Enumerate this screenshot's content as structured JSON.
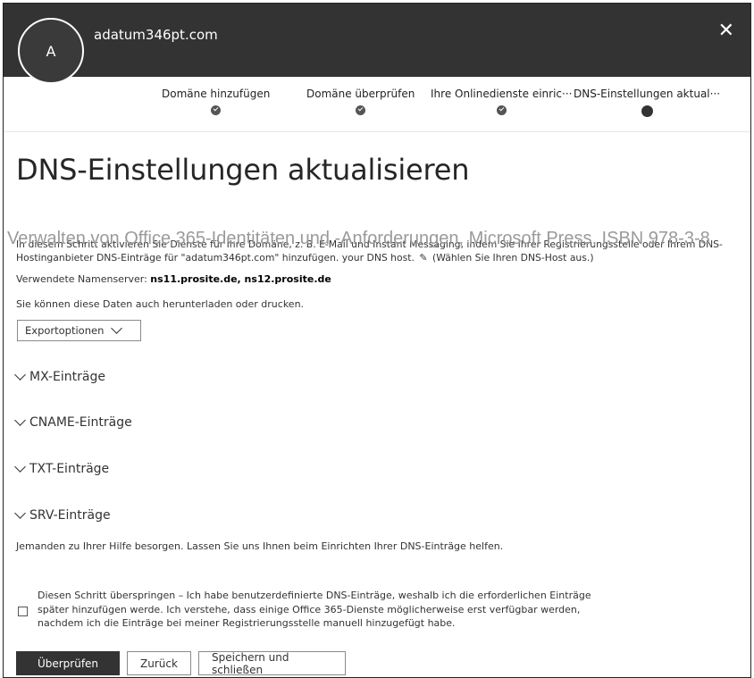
{
  "header": {
    "avatar_initial": "A",
    "domain": "adatum346pt.com",
    "close_glyph": "✕"
  },
  "steps": [
    {
      "label": "Domäne hinzufügen",
      "state": "done"
    },
    {
      "label": "Domäne überprüfen",
      "state": "done"
    },
    {
      "label": "Ihre Onlinedienste einric···",
      "state": "done"
    },
    {
      "label": "DNS-Einstellungen aktual···",
      "state": "current"
    }
  ],
  "page": {
    "title": "DNS-Einstellungen aktualisieren",
    "intro_text": "In diesem Schritt aktivieren Sie Dienste für Ihre Domäne, z. B. E-Mail und Instant Messaging, indem Sie Ihrer Registrierungsstelle oder Ihrem DNS-Hostinganbieter DNS-Einträge für \"adatum346pt.com\" hinzufügen. your DNS host.",
    "edit_icon_glyph": "✎",
    "choose_host_text": "(Wählen Sie Ihren DNS-Host aus.)",
    "nameserver_label": "Verwendete Namenserver:",
    "nameserver_values": "ns11.prosite.de, ns12.prosite.de",
    "download_text": "Sie können diese Daten auch herunterladen oder drucken.",
    "export_label": "Exportoptionen"
  },
  "sections": [
    {
      "label": "MX-Einträge"
    },
    {
      "label": "CNAME-Einträge"
    },
    {
      "label": "TXT-Einträge"
    },
    {
      "label": "SRV-Einträge"
    }
  ],
  "watermark": "Verwalten von Office 365-Identitäten und -Anforderungen, Microsoft Press, ISBN 978-3-8",
  "help_text": "Jemanden zu Ihrer Hilfe besorgen. Lassen Sie uns Ihnen beim Einrichten Ihrer DNS-Einträge helfen.",
  "skip": {
    "checked": false,
    "text": "Diesen Schritt überspringen – Ich habe benutzerdefinierte DNS-Einträge, weshalb ich die erforderlichen Einträge später hinzufügen werde. Ich verstehe, dass einige Office 365-Dienste möglicherweise erst verfügbar werden, nachdem ich die Einträge bei meiner Registrierungsstelle manuell hinzugefügt habe."
  },
  "buttons": {
    "verify": "Überprüfen",
    "back": "Zurück",
    "save_close": "Speichern und schließen"
  },
  "colors": {
    "header_bg": "#333333",
    "primary_button": "#333333"
  },
  "icons": {
    "close": "close-icon",
    "edit": "pencil-icon",
    "step_done": "check-icon",
    "expand": "chevron-down-icon"
  }
}
